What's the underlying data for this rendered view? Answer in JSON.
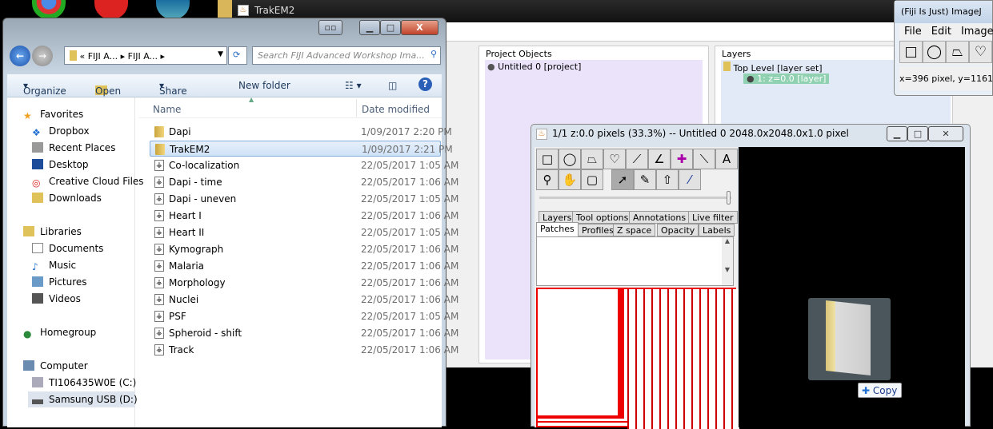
{
  "desktop": {
    "icons": [
      "chrome-icon",
      "itunes-icon",
      "app-icon",
      "folder-icon"
    ]
  },
  "trakem2": {
    "title": "TrakEM2",
    "project_objects": {
      "header": "Project Objects",
      "items": [
        "Untitled 0 [project]"
      ]
    },
    "layers": {
      "header": "Layers",
      "items": [
        "Top Level [layer set]",
        "1:  z=0.0 [layer]"
      ]
    }
  },
  "fiji": {
    "title": "(Fiji Is Just) ImageJ",
    "menu": [
      "File",
      "Edit",
      "Image"
    ],
    "status": "x=396 pixel, y=1161"
  },
  "explorer": {
    "breadcrumb": [
      "«",
      "FIJI A...",
      "FIJI A..."
    ],
    "search_placeholder": "Search FIJI Advanced Workshop Ima...",
    "toolbar": {
      "organize": "Organize",
      "open": "Open",
      "share_with": "Share with",
      "new_folder": "New folder"
    },
    "sidebar": [
      {
        "label": "Favorites",
        "group": true
      },
      {
        "label": "Dropbox"
      },
      {
        "label": "Recent Places"
      },
      {
        "label": "Desktop"
      },
      {
        "label": "Creative Cloud Files"
      },
      {
        "label": "Downloads"
      },
      {
        "label": "Libraries",
        "group": true
      },
      {
        "label": "Documents"
      },
      {
        "label": "Music"
      },
      {
        "label": "Pictures"
      },
      {
        "label": "Videos"
      },
      {
        "label": "Homegroup",
        "group": true
      },
      {
        "label": "Computer",
        "group": true
      },
      {
        "label": "TI106435W0E (C:)"
      },
      {
        "label": "Samsung USB (D:)",
        "selected": true
      }
    ],
    "columns": [
      "Name",
      "Date modified"
    ],
    "files": [
      {
        "name": "Dapi",
        "date": "1/09/2017 2:20 PM",
        "type": "folder"
      },
      {
        "name": "TrakEM2",
        "date": "1/09/2017 2:21 PM",
        "type": "folder",
        "selected": true
      },
      {
        "name": "Co-localization",
        "date": "22/05/2017 1:05 AM",
        "type": "file"
      },
      {
        "name": "Dapi - time",
        "date": "22/05/2017 1:06 AM",
        "type": "file"
      },
      {
        "name": "Dapi - uneven",
        "date": "22/05/2017 1:05 AM",
        "type": "file"
      },
      {
        "name": "Heart I",
        "date": "22/05/2017 1:06 AM",
        "type": "file"
      },
      {
        "name": "Heart II",
        "date": "22/05/2017 1:05 AM",
        "type": "file"
      },
      {
        "name": "Kymograph",
        "date": "22/05/2017 1:06 AM",
        "type": "file"
      },
      {
        "name": "Malaria",
        "date": "22/05/2017 1:06 AM",
        "type": "file"
      },
      {
        "name": "Morphology",
        "date": "22/05/2017 1:06 AM",
        "type": "file"
      },
      {
        "name": "Nuclei",
        "date": "22/05/2017 1:06 AM",
        "type": "file"
      },
      {
        "name": "PSF",
        "date": "22/05/2017 1:05 AM",
        "type": "file"
      },
      {
        "name": "Spheroid - shift",
        "date": "22/05/2017 1:06 AM",
        "type": "file"
      },
      {
        "name": "Track",
        "date": "22/05/2017 1:06 AM",
        "type": "file"
      }
    ]
  },
  "display": {
    "title": "1/1  z:0.0 pixels   (33.3%) -- Untitled 0  2048.0x2048.0x1.0 pixel",
    "tabs_row1": [
      "Layers",
      "Tool options",
      "Annotations",
      "Live filter"
    ],
    "tabs_row2": [
      "Patches",
      "Profiles",
      "Z space",
      "Opacity",
      "Labels"
    ],
    "active_tab": "Patches"
  },
  "drag": {
    "tooltip": "Copy"
  }
}
